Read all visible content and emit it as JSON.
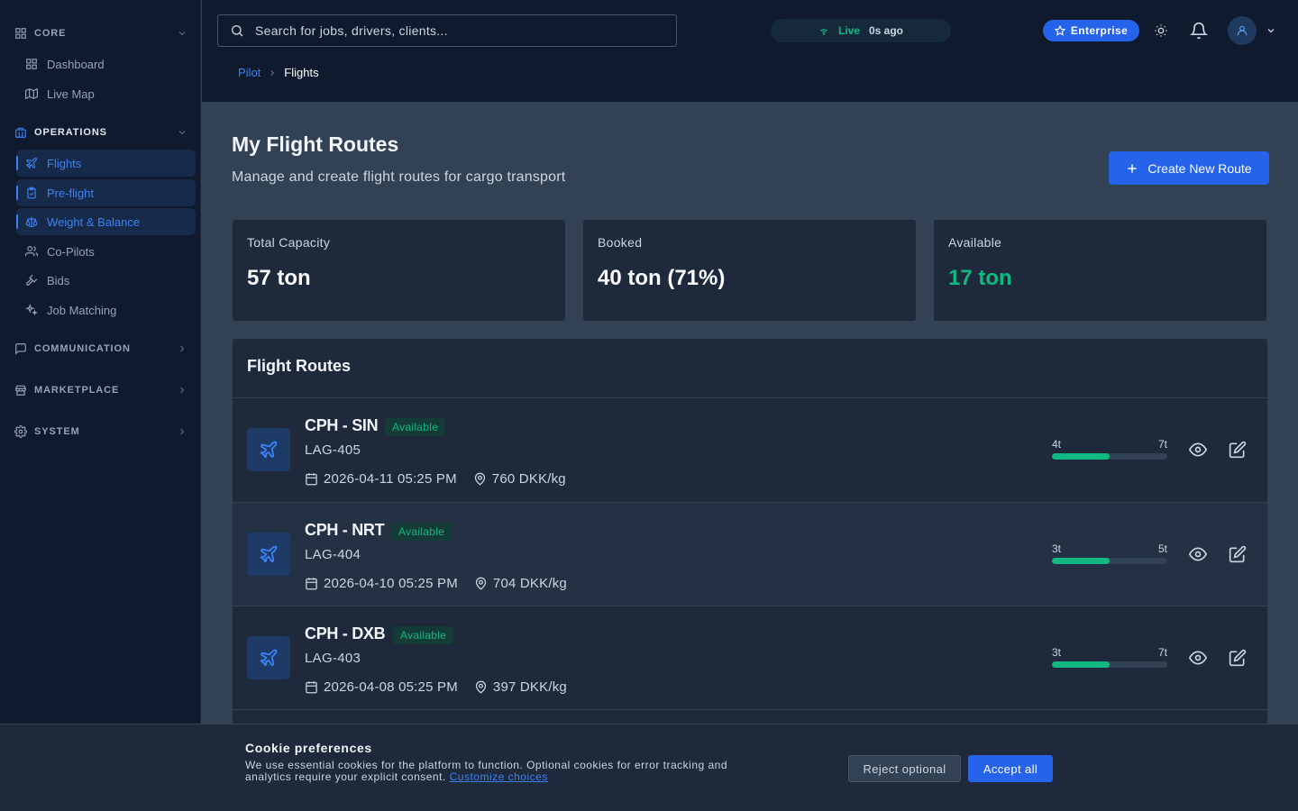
{
  "sidebar": {
    "sections": {
      "core": {
        "label": "CORE",
        "icon": "grid-icon"
      },
      "operations": {
        "label": "OPERATIONS",
        "icon": "building-icon"
      },
      "communication": {
        "label": "COMMUNICATION",
        "icon": "chat-icon"
      },
      "marketplace": {
        "label": "MARKETPLACE",
        "icon": "store-icon"
      },
      "system": {
        "label": "SYSTEM",
        "icon": "gear-icon"
      }
    },
    "items": {
      "dashboard": "Dashboard",
      "live_map": "Live Map",
      "flights": "Flights",
      "preflight": "Pre-flight",
      "weight_balance": "Weight & Balance",
      "copilots": "Co-Pilots",
      "bids": "Bids",
      "job_matching": "Job Matching"
    }
  },
  "topbar": {
    "search_placeholder": "Search for jobs, drivers, clients...",
    "live_label": "Live",
    "live_ago": "0s ago",
    "plan_badge": "Enterprise"
  },
  "breadcrumb": {
    "root": "Pilot",
    "current": "Flights"
  },
  "page": {
    "title": "My Flight Routes",
    "subtitle": "Manage and create flight routes for cargo transport",
    "create_button": "Create New Route"
  },
  "stats": {
    "total": {
      "label": "Total Capacity",
      "value": "57 ton"
    },
    "booked": {
      "label": "Booked",
      "value": "40 ton (71%)"
    },
    "available": {
      "label": "Available",
      "value": "17 ton"
    }
  },
  "routes": {
    "title": "Flight Routes",
    "rows": [
      {
        "route": "CPH - SIN",
        "status": "Available",
        "code": "LAG-405",
        "date": "2026-04-11 05:25 PM",
        "price": "760 DKK/kg",
        "cap_min": "4t",
        "cap_max": "7t",
        "fill_pct": 50
      },
      {
        "route": "CPH - NRT",
        "status": "Available",
        "code": "LAG-404",
        "date": "2026-04-10 05:25 PM",
        "price": "704 DKK/kg",
        "cap_min": "3t",
        "cap_max": "5t",
        "fill_pct": 50
      },
      {
        "route": "CPH - DXB",
        "status": "Available",
        "code": "LAG-403",
        "date": "2026-04-08 05:25 PM",
        "price": "397 DKK/kg",
        "cap_min": "3t",
        "cap_max": "7t",
        "fill_pct": 50
      }
    ]
  },
  "cookie": {
    "title": "Cookie preferences",
    "text": "We use essential cookies for the platform to function. Optional cookies for error tracking and analytics require your explicit consent.",
    "link": "Customize choices",
    "reject": "Reject optional",
    "accept": "Accept all"
  },
  "colors": {
    "accent": "#2563eb",
    "success": "#10b981",
    "sidebar_bg": "#0f1a2e",
    "main_bg": "#334155"
  }
}
